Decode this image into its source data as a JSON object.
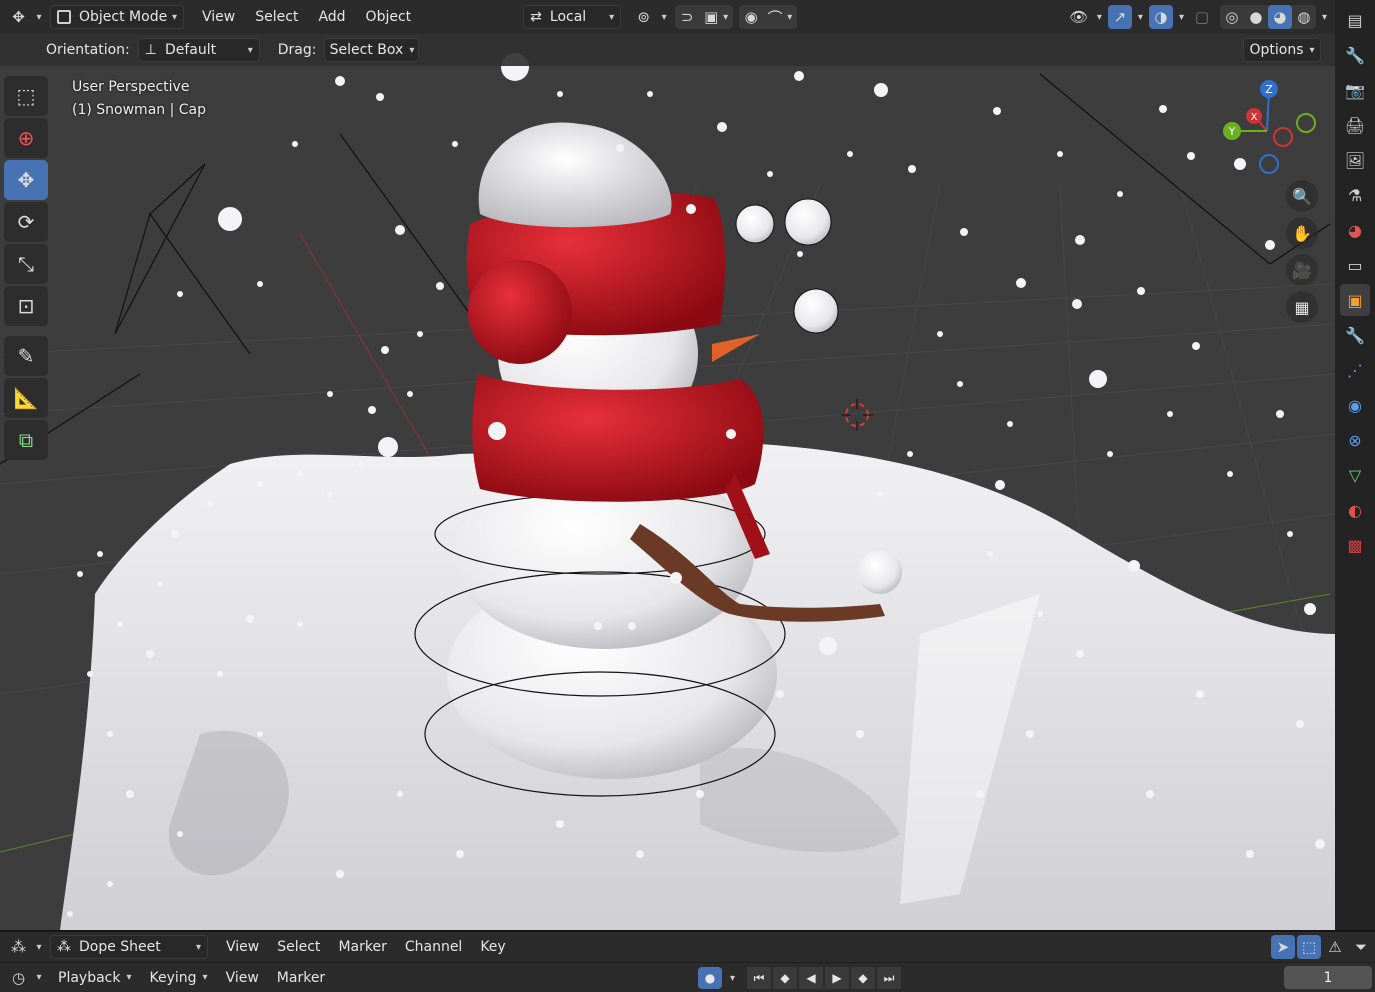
{
  "header": {
    "editor_type_icon": "move-gizmo-icon",
    "mode": "Object Mode",
    "menus": [
      "View",
      "Select",
      "Add",
      "Object"
    ],
    "transform_space": "Local",
    "icons": [
      "pivot-icon",
      "snap-icon",
      "snap-target-icon",
      "proportional-editing-icon",
      "falloff-icon",
      "visibility-icon",
      "gizmo-icon",
      "overlay-icon",
      "xray-icon",
      "wireframe-shading-icon",
      "solid-shading-icon",
      "material-shading-icon",
      "rendered-shading-icon"
    ]
  },
  "tool_settings": {
    "orientation_label": "Orientation:",
    "orientation_value": "Default",
    "drag_label": "Drag:",
    "drag_value": "Select Box",
    "options_label": "Options"
  },
  "viewport": {
    "perspective": "User Perspective",
    "object_info": "(1) Snowman | Cap",
    "colors": {
      "background": "#3d3d3d",
      "snow": "#e9e9ec",
      "scarf": "#c4121c",
      "nose": "#e0622a",
      "branch": "#6a3a26"
    }
  },
  "toolbar": {
    "tools": [
      "select-box-icon",
      "cursor-icon",
      "move-icon",
      "rotate-icon",
      "scale-icon",
      "transform-icon",
      "annotate-icon",
      "measure-icon",
      "add-cube-icon"
    ],
    "active": "move-icon"
  },
  "gizmo": {
    "axes": [
      "Z",
      "X",
      "Y"
    ]
  },
  "nav": [
    "zoom-icon",
    "hand-pan-icon",
    "camera-icon",
    "grid-icon"
  ],
  "properties_tabs": [
    "tool-icon",
    "render-icon",
    "output-icon",
    "view-layer-icon",
    "scene-icon",
    "world-icon",
    "collection-icon",
    "object-icon",
    "modifier-icon",
    "particles-icon",
    "physics-icon",
    "constraints-icon",
    "data-icon",
    "material-icon",
    "texture-icon"
  ],
  "dopesheet": {
    "editor_name": "Dope Sheet",
    "menus": [
      "View",
      "Select",
      "Marker",
      "Channel",
      "Key"
    ]
  },
  "timeline": {
    "menus": [
      "Playback",
      "Keying",
      "View",
      "Marker"
    ],
    "current_frame": "1"
  }
}
